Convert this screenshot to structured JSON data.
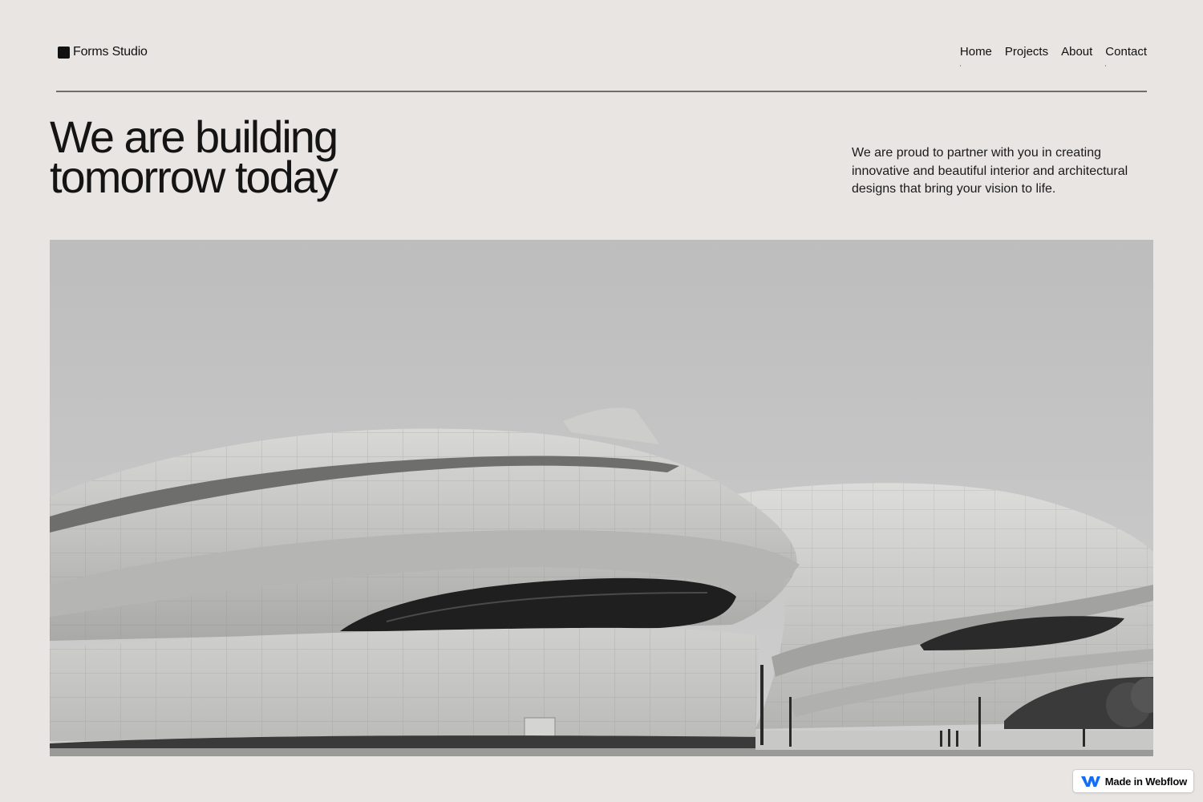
{
  "brand": {
    "name": "Forms Studio",
    "icon": "square-logo-icon"
  },
  "nav": {
    "items": [
      {
        "label": "Home"
      },
      {
        "label": "Projects"
      },
      {
        "label": "About"
      },
      {
        "label": "Contact"
      }
    ]
  },
  "hero": {
    "title_line1": "We are building",
    "title_line2": "tomorrow today",
    "description": "We are proud to partner with you in creating innovative and beautiful interior and architectural designs that bring your vision to life.",
    "image": "black-and-white-curved-architecture-photo"
  },
  "badge": {
    "label": "Made in Webflow",
    "icon": "webflow-logo-icon",
    "color": "#146ef5"
  },
  "colors": {
    "background": "#e8e5e3",
    "text": "#141414",
    "rule": "#6f6d6b"
  }
}
